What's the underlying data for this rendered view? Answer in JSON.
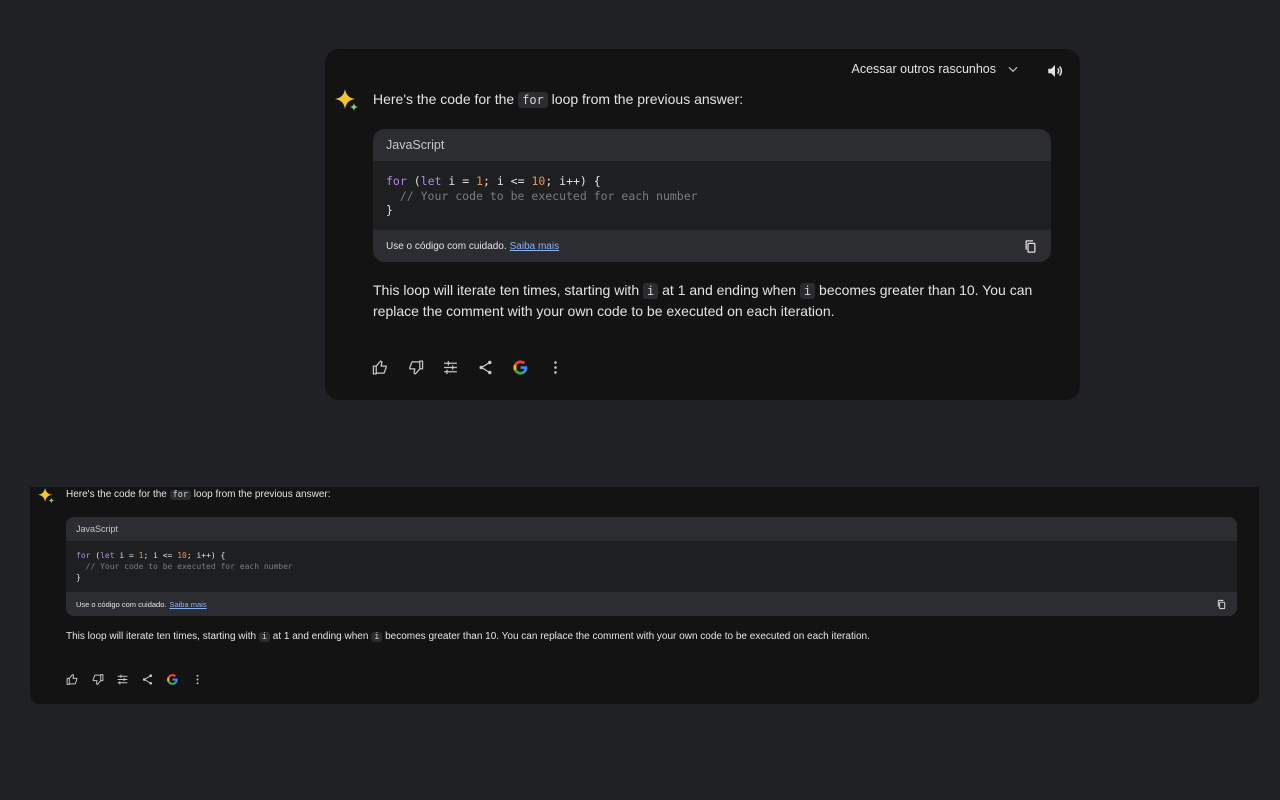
{
  "drafts_label": "Acessar outros rascunhos",
  "intro": {
    "before": "Here's the code for the",
    "code": "for",
    "after": "loop from the previous answer:"
  },
  "code_block": {
    "language": "JavaScript",
    "line1": {
      "kw1": "for",
      "p1": " (",
      "kw2": "let",
      "p2": " i = ",
      "n1": "1",
      "p3": "; i <= ",
      "n2": "10",
      "p4": "; i++) {"
    },
    "line2": "  // Your code to be executed for each number",
    "line3": "}",
    "caution": "Use o código com cuidado.",
    "learn_more": "Saiba mais"
  },
  "answer": {
    "p1": "This loop will iterate ten times, starting with",
    "c1": "i",
    "p2": "at 1 and ending when",
    "c2": "i",
    "p3": "becomes greater than 10. You can replace the comment with your own code to be executed on each iteration."
  },
  "icons": [
    "sparkle-icon",
    "chevron-down-icon",
    "speaker-icon",
    "copy-icon",
    "thumbs-up-icon",
    "thumbs-down-icon",
    "tune-icon",
    "share-icon",
    "google-icon",
    "more-vert-icon"
  ],
  "colors": {
    "background": "#202124",
    "card": "#131314",
    "keyword": "#b487e8",
    "number": "#f28b54",
    "link": "#8ab4f8"
  }
}
